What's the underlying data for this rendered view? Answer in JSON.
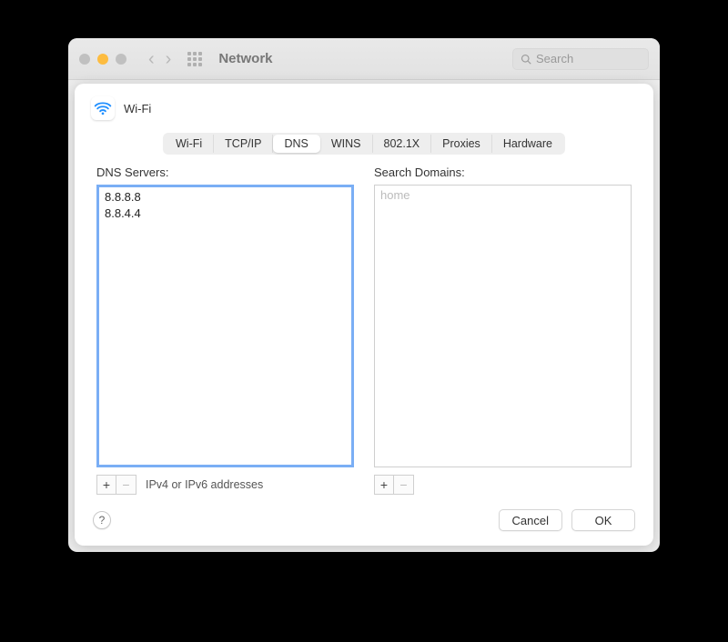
{
  "window": {
    "title": "Network",
    "search_placeholder": "Search"
  },
  "header": {
    "interface": "Wi-Fi"
  },
  "tabs": {
    "items": [
      "Wi-Fi",
      "TCP/IP",
      "DNS",
      "WINS",
      "802.1X",
      "Proxies",
      "Hardware"
    ],
    "active_index": 2
  },
  "dns": {
    "label": "DNS Servers:",
    "servers": [
      "8.8.8.8",
      "8.8.4.4"
    ],
    "hint": "IPv4 or IPv6 addresses",
    "add": "+",
    "remove": "−"
  },
  "search_domains": {
    "label": "Search Domains:",
    "placeholder": "home",
    "add": "+",
    "remove": "−"
  },
  "footer": {
    "help": "?",
    "cancel": "Cancel",
    "ok": "OK"
  }
}
